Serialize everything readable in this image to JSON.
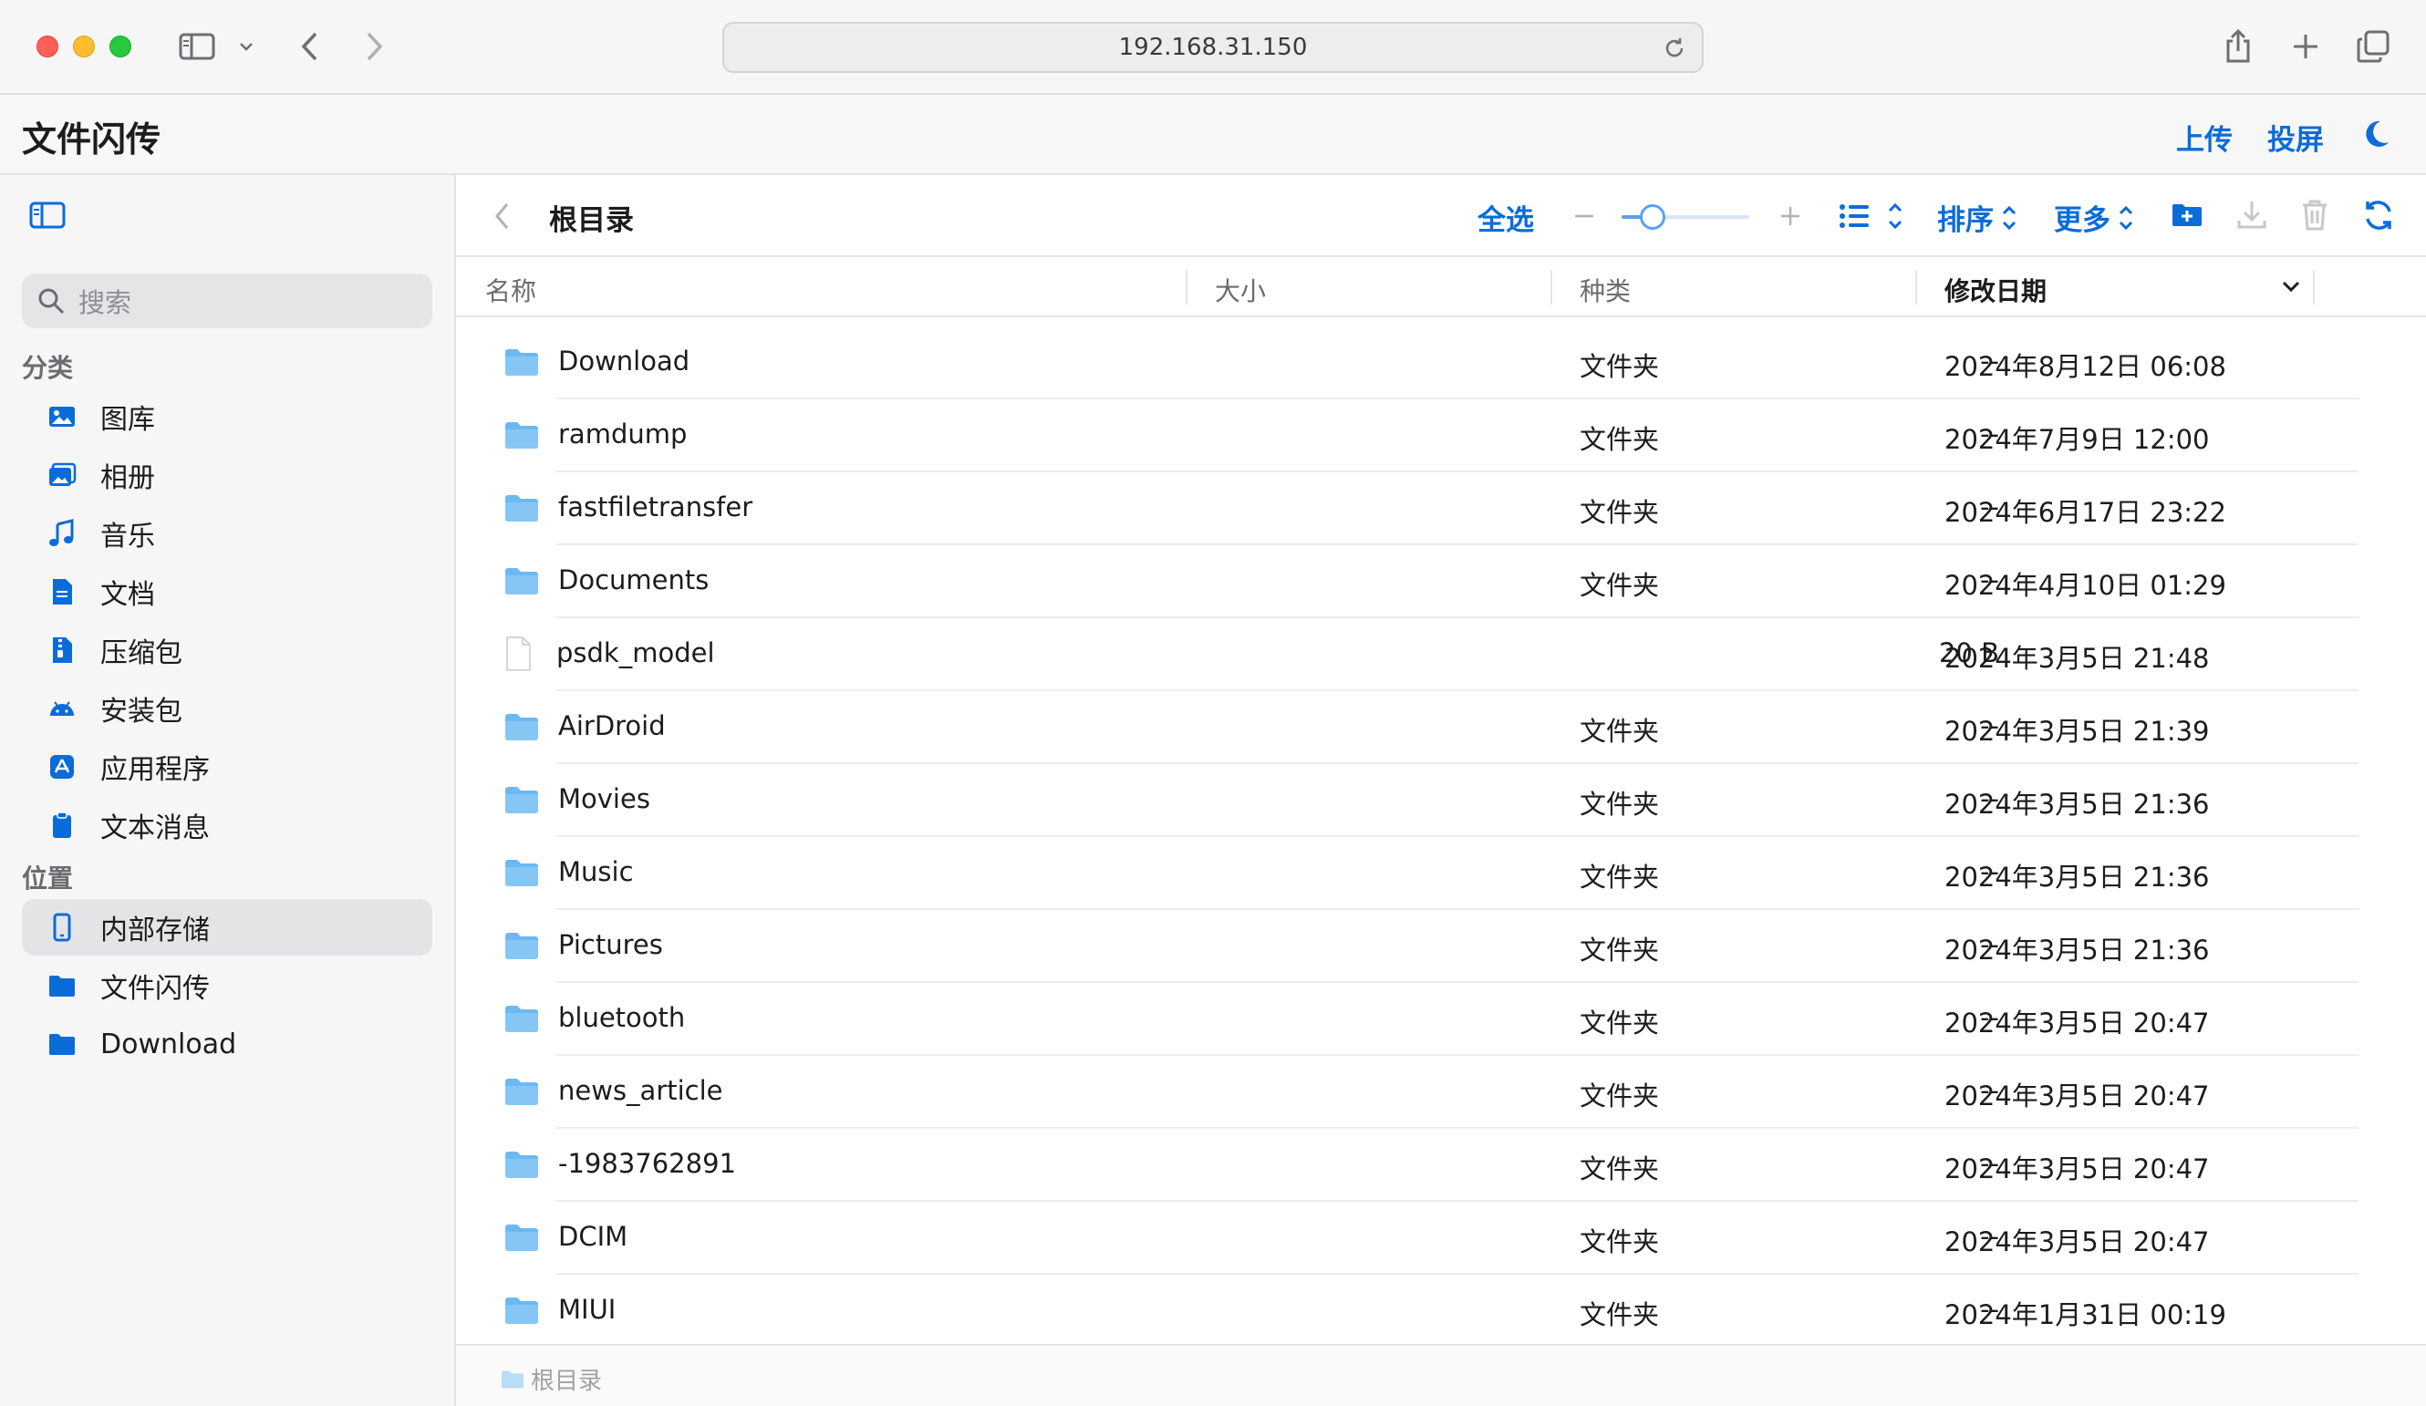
{
  "browser": {
    "address": "192.168.31.150"
  },
  "app": {
    "title": "文件闪传",
    "upload_label": "上传",
    "cast_label": "投屏"
  },
  "sidebar": {
    "search_placeholder": "搜索",
    "categories_heading": "分类",
    "categories": [
      {
        "label": "图库",
        "icon": "photo-icon"
      },
      {
        "label": "相册",
        "icon": "album-icon"
      },
      {
        "label": "音乐",
        "icon": "music-icon"
      },
      {
        "label": "文档",
        "icon": "document-icon"
      },
      {
        "label": "压缩包",
        "icon": "archive-icon"
      },
      {
        "label": "安装包",
        "icon": "android-icon"
      },
      {
        "label": "应用程序",
        "icon": "app-store-icon"
      },
      {
        "label": "文本消息",
        "icon": "message-clipboard-icon"
      }
    ],
    "locations_heading": "位置",
    "locations": [
      {
        "label": "内部存储",
        "icon": "phone-icon",
        "active": true
      },
      {
        "label": "文件闪传",
        "icon": "folder-icon"
      },
      {
        "label": "Download",
        "icon": "folder-icon"
      }
    ]
  },
  "toolbar": {
    "title": "根目录",
    "select_all": "全选",
    "sort_label": "排序",
    "more_label": "更多"
  },
  "columns": {
    "name": "名称",
    "size": "大小",
    "kind": "种类",
    "modified": "修改日期"
  },
  "files": [
    {
      "name": "Download",
      "size": "--",
      "kind": "文件夹",
      "date": "2024年8月12日 06:08",
      "type": "folder"
    },
    {
      "name": "ramdump",
      "size": "--",
      "kind": "文件夹",
      "date": "2024年7月9日 12:00",
      "type": "folder"
    },
    {
      "name": "fastfiletransfer",
      "size": "--",
      "kind": "文件夹",
      "date": "2024年6月17日 23:22",
      "type": "folder"
    },
    {
      "name": "Documents",
      "size": "--",
      "kind": "文件夹",
      "date": "2024年4月10日 01:29",
      "type": "folder"
    },
    {
      "name": "psdk_model",
      "size": "20 B",
      "kind": "",
      "date": "2024年3月5日 21:48",
      "type": "file"
    },
    {
      "name": "AirDroid",
      "size": "--",
      "kind": "文件夹",
      "date": "2024年3月5日 21:39",
      "type": "folder"
    },
    {
      "name": "Movies",
      "size": "--",
      "kind": "文件夹",
      "date": "2024年3月5日 21:36",
      "type": "folder"
    },
    {
      "name": "Music",
      "size": "--",
      "kind": "文件夹",
      "date": "2024年3月5日 21:36",
      "type": "folder"
    },
    {
      "name": "Pictures",
      "size": "--",
      "kind": "文件夹",
      "date": "2024年3月5日 21:36",
      "type": "folder"
    },
    {
      "name": "bluetooth",
      "size": "--",
      "kind": "文件夹",
      "date": "2024年3月5日 20:47",
      "type": "folder"
    },
    {
      "name": "news_article",
      "size": "--",
      "kind": "文件夹",
      "date": "2024年3月5日 20:47",
      "type": "folder"
    },
    {
      "name": "-1983762891",
      "size": "--",
      "kind": "文件夹",
      "date": "2024年3月5日 20:47",
      "type": "folder"
    },
    {
      "name": "DCIM",
      "size": "--",
      "kind": "文件夹",
      "date": "2024年3月5日 20:47",
      "type": "folder"
    },
    {
      "name": "MIUI",
      "size": "--",
      "kind": "文件夹",
      "date": "2024年1月31日 00:19",
      "type": "folder"
    }
  ],
  "statusbar": {
    "path": "根目录"
  },
  "colors": {
    "accent": "#0a6cd8",
    "folder": "#6cb8f2",
    "sidebar_icon": "#0a6cd8"
  }
}
